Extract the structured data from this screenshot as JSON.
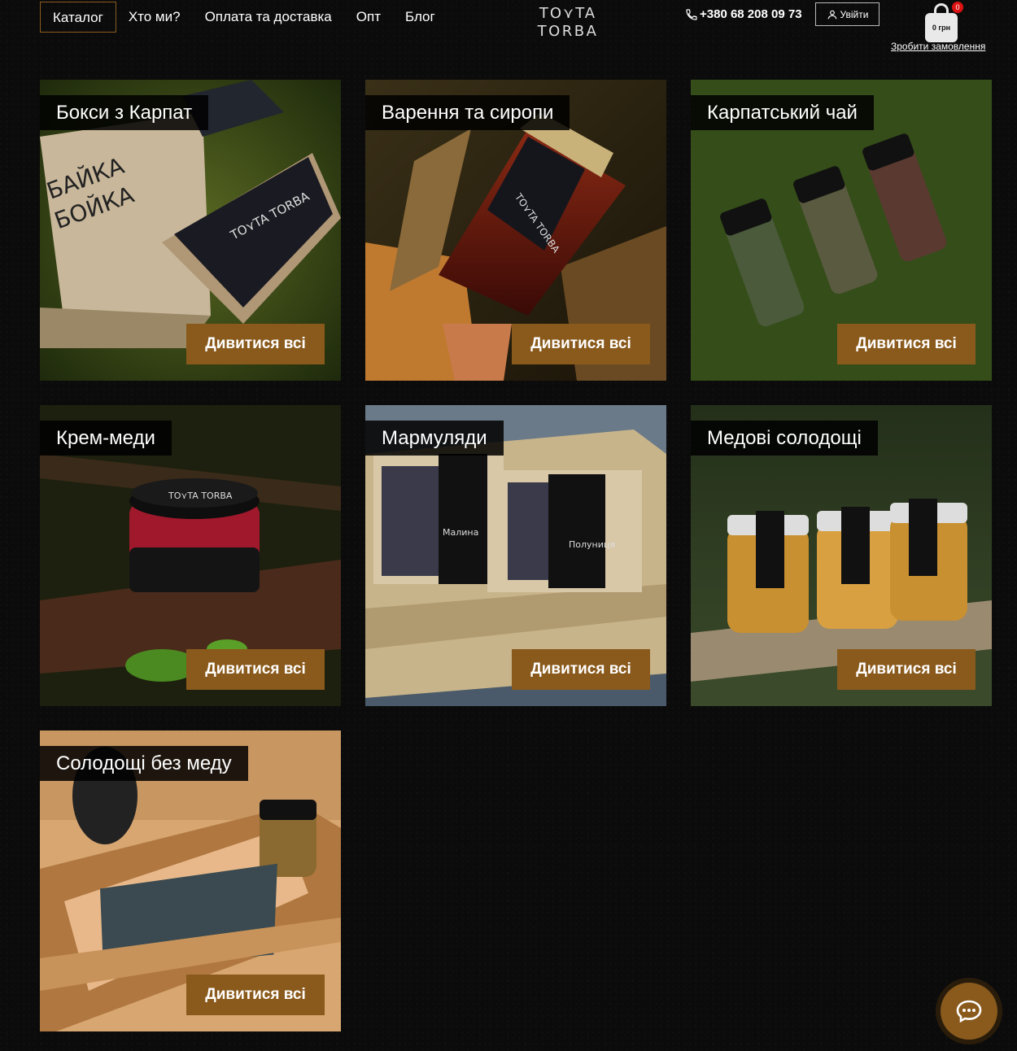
{
  "nav": [
    {
      "label": "Каталог",
      "active": true
    },
    {
      "label": "Хто ми?"
    },
    {
      "label": "Оплата та доставка"
    },
    {
      "label": "Опт"
    },
    {
      "label": "Блог"
    }
  ],
  "logo": {
    "line1": "TO⋎TA",
    "line2": "TORBA"
  },
  "phone": "+380 68 208 09 73",
  "login_label": "Увійти",
  "cart": {
    "total": "0 грн",
    "count": "0"
  },
  "order_link": "Зробити замовлення",
  "categories": [
    {
      "title": "Бокси з Карпат",
      "button": "Дивитися всі"
    },
    {
      "title": "Варення та сиропи",
      "button": "Дивитися всі"
    },
    {
      "title": "Карпатський чай",
      "button": "Дивитися всі"
    },
    {
      "title": "Крем-меди",
      "button": "Дивитися всі"
    },
    {
      "title": "Мармуляди",
      "button": "Дивитися всі"
    },
    {
      "title": "Медові солодощі",
      "button": "Дивитися всі"
    },
    {
      "title": "Солодощі без меду",
      "button": "Дивитися всі"
    }
  ],
  "colors": {
    "accent": "#8a5a1c",
    "background": "#0b0b0b"
  },
  "icons": {
    "phone": "phone-icon",
    "user": "user-icon",
    "cart": "shopping-bag-icon",
    "chat": "chat-bubble-icon"
  }
}
